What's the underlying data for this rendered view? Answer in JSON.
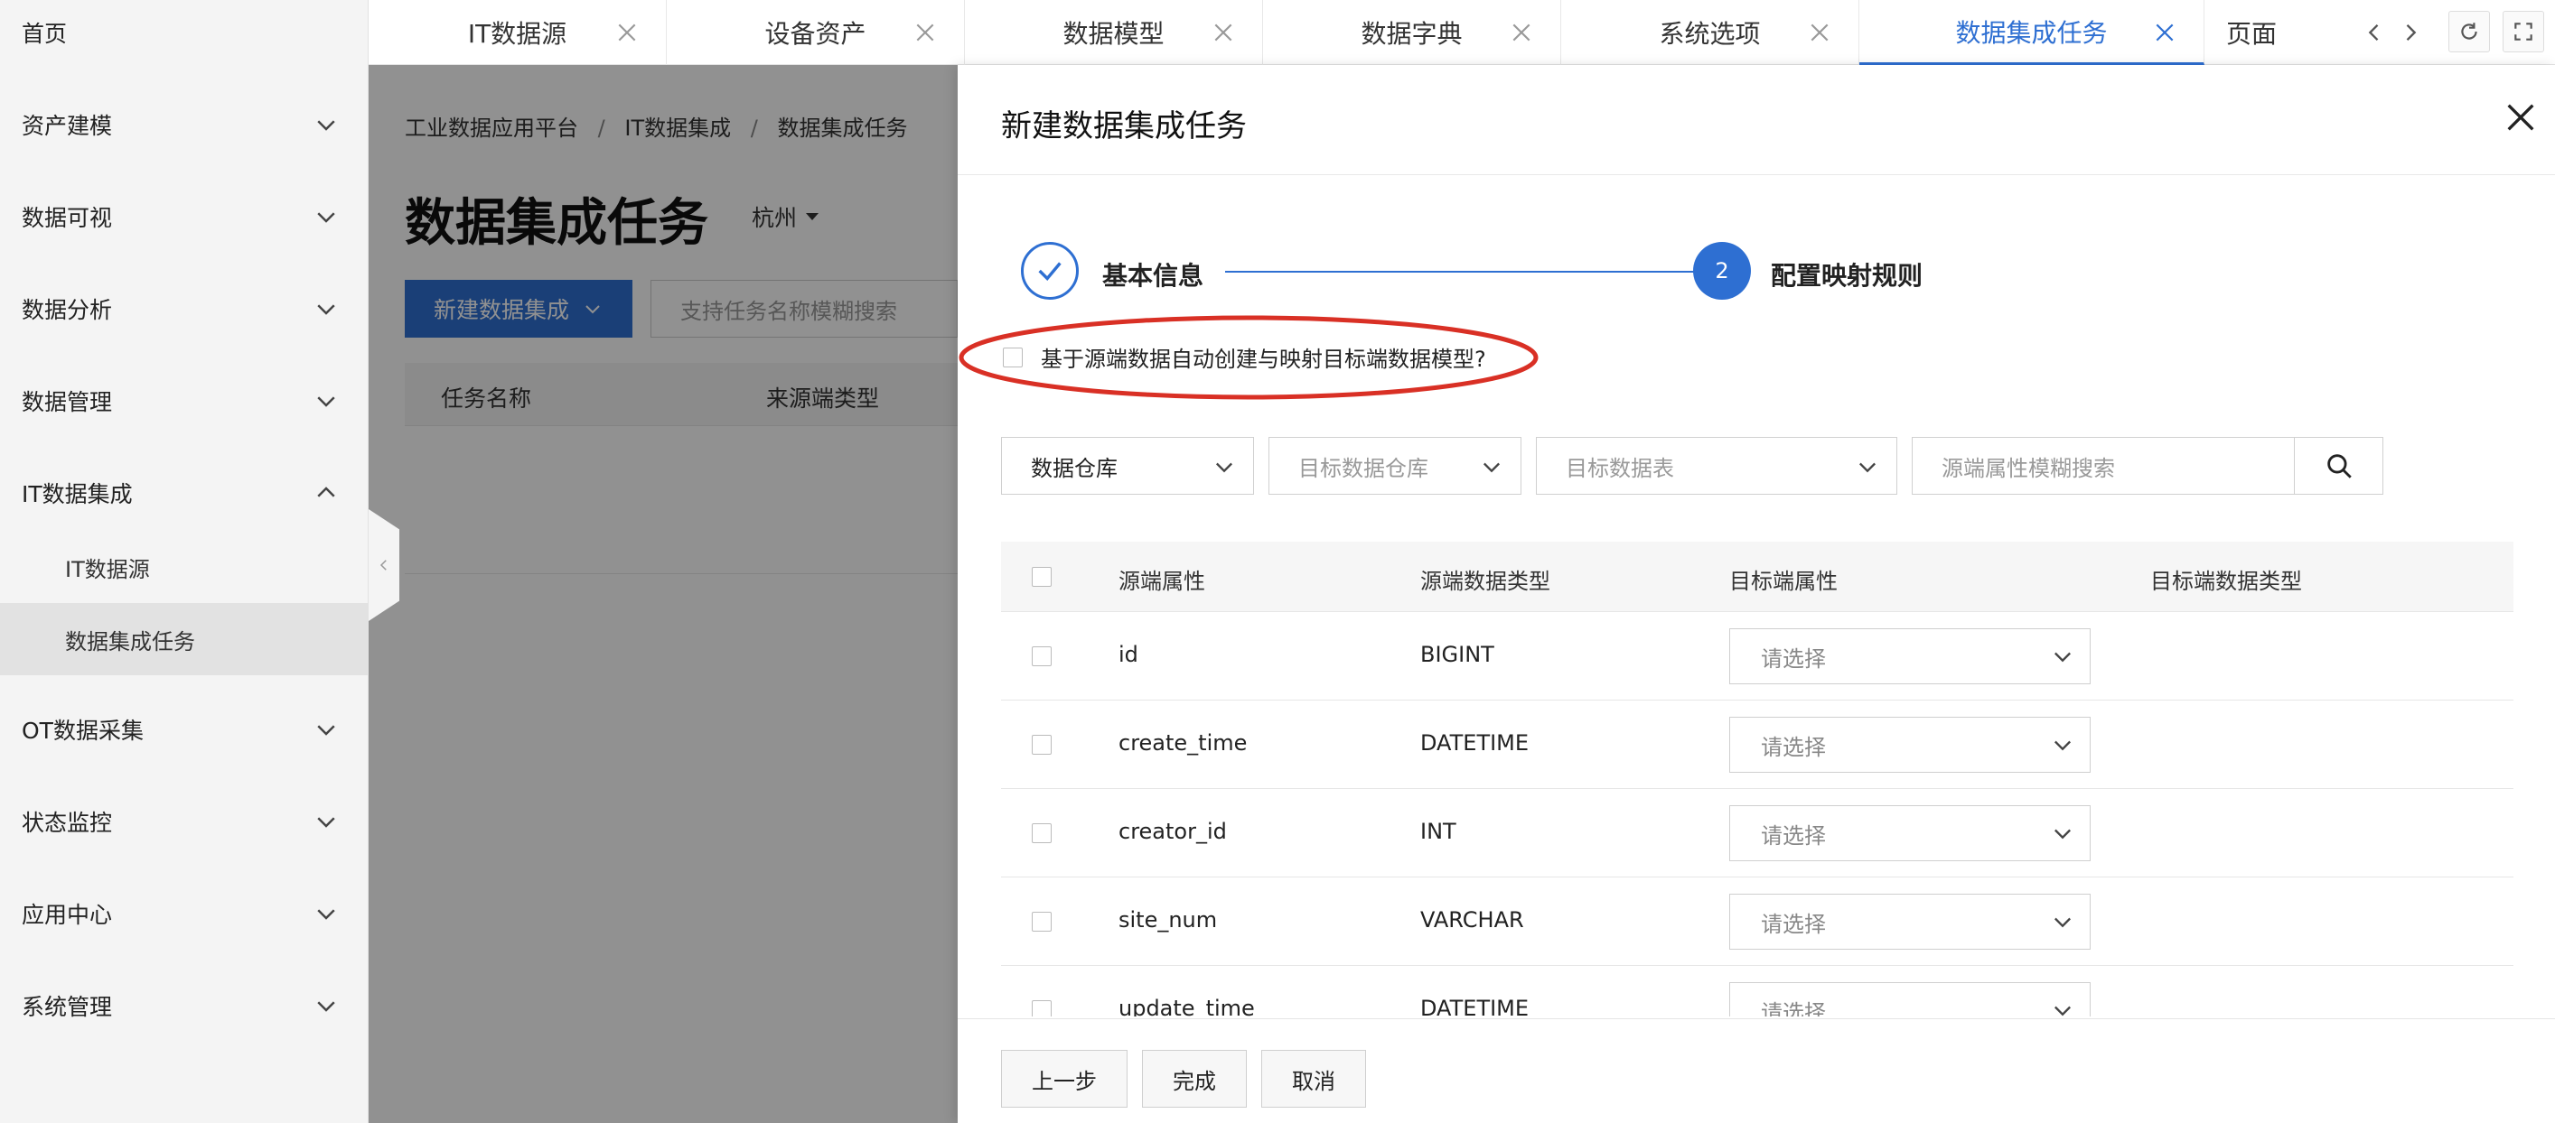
{
  "sidebar": {
    "home": "首页",
    "items": [
      {
        "label": "资产建模"
      },
      {
        "label": "数据可视"
      },
      {
        "label": "数据分析"
      },
      {
        "label": "数据管理"
      },
      {
        "label": "IT数据集成"
      },
      {
        "label": "OT数据采集"
      },
      {
        "label": "状态监控"
      },
      {
        "label": "应用中心"
      },
      {
        "label": "系统管理"
      }
    ],
    "subitems": [
      {
        "label": "IT数据源"
      },
      {
        "label": "数据集成任务"
      }
    ]
  },
  "tabs": [
    {
      "label": "IT数据源"
    },
    {
      "label": "设备资产"
    },
    {
      "label": "数据模型"
    },
    {
      "label": "数据字典"
    },
    {
      "label": "系统选项"
    },
    {
      "label": "数据集成任务"
    },
    {
      "label": "页面"
    }
  ],
  "bgpage": {
    "breadcrumb": [
      "工业数据应用平台",
      "IT数据集成",
      "数据集成任务"
    ],
    "separator": "/",
    "title": "数据集成任务",
    "city": "杭州",
    "new_button": "新建数据集成",
    "search_placeholder": "支持任务名称模糊搜索",
    "columns": [
      "任务名称",
      "来源端类型"
    ]
  },
  "drawer": {
    "title": "新建数据集成任务",
    "steps": [
      {
        "label": "基本信息"
      },
      {
        "number": "2",
        "label": "配置映射规则"
      }
    ],
    "auto_create_label": "基于源端数据自动创建与映射目标端数据模型?",
    "filters": {
      "source_select": "数据仓库",
      "target_warehouse_placeholder": "目标数据仓库",
      "target_table_placeholder": "目标数据表",
      "search_placeholder": "源端属性模糊搜索"
    },
    "table": {
      "columns": [
        "源端属性",
        "源端数据类型",
        "目标端属性",
        "目标端数据类型"
      ],
      "select_placeholder": "请选择",
      "rows": [
        {
          "attr": "id",
          "type": "BIGINT"
        },
        {
          "attr": "create_time",
          "type": "DATETIME"
        },
        {
          "attr": "creator_id",
          "type": "INT"
        },
        {
          "attr": "site_num",
          "type": "VARCHAR"
        },
        {
          "attr": "update_time",
          "type": "DATETIME"
        }
      ]
    },
    "footer": {
      "prev": "上一步",
      "finish": "完成",
      "cancel": "取消"
    }
  },
  "colors": {
    "primary": "#2e6fd2",
    "annotation": "#d93025"
  }
}
